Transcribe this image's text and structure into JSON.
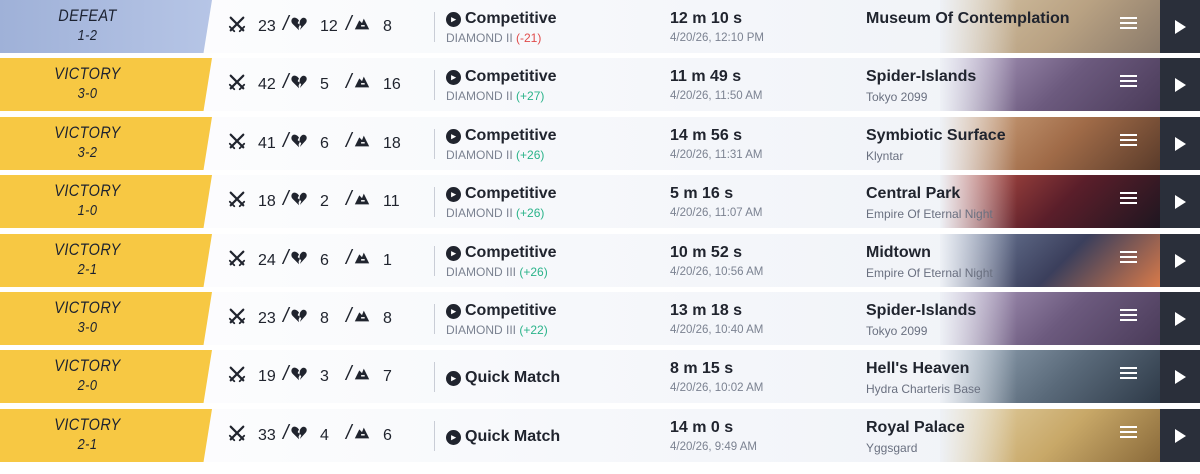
{
  "matches": [
    {
      "result": "DEFEAT",
      "score": "1-2",
      "kills": "23",
      "deaths": "12",
      "assists": "8",
      "mode": "Competitive",
      "rank": "DIAMOND II",
      "rank_change": "(-21)",
      "change_sign": "neg",
      "duration": "12 m 10 s",
      "date": "4/20/26, 12:10 PM",
      "map": "Museum Of Contemplation",
      "region": ""
    },
    {
      "result": "VICTORY",
      "score": "3-0",
      "kills": "42",
      "deaths": "5",
      "assists": "16",
      "mode": "Competitive",
      "rank": "DIAMOND II",
      "rank_change": "(+27)",
      "change_sign": "pos",
      "duration": "11 m 49 s",
      "date": "4/20/26, 11:50 AM",
      "map": "Spider-Islands",
      "region": "Tokyo 2099"
    },
    {
      "result": "VICTORY",
      "score": "3-2",
      "kills": "41",
      "deaths": "6",
      "assists": "18",
      "mode": "Competitive",
      "rank": "DIAMOND II",
      "rank_change": "(+26)",
      "change_sign": "pos",
      "duration": "14 m 56 s",
      "date": "4/20/26, 11:31 AM",
      "map": "Symbiotic Surface",
      "region": "Klyntar"
    },
    {
      "result": "VICTORY",
      "score": "1-0",
      "kills": "18",
      "deaths": "2",
      "assists": "11",
      "mode": "Competitive",
      "rank": "DIAMOND II",
      "rank_change": "(+26)",
      "change_sign": "pos",
      "duration": "5 m 16 s",
      "date": "4/20/26, 11:07 AM",
      "map": "Central Park",
      "region": "Empire Of Eternal Night"
    },
    {
      "result": "VICTORY",
      "score": "2-1",
      "kills": "24",
      "deaths": "6",
      "assists": "1",
      "mode": "Competitive",
      "rank": "DIAMOND III",
      "rank_change": "(+26)",
      "change_sign": "pos",
      "duration": "10 m 52 s",
      "date": "4/20/26, 10:56 AM",
      "map": "Midtown",
      "region": "Empire Of Eternal Night"
    },
    {
      "result": "VICTORY",
      "score": "3-0",
      "kills": "23",
      "deaths": "8",
      "assists": "8",
      "mode": "Competitive",
      "rank": "DIAMOND III",
      "rank_change": "(+22)",
      "change_sign": "pos",
      "duration": "13 m 18 s",
      "date": "4/20/26, 10:40 AM",
      "map": "Spider-Islands",
      "region": "Tokyo 2099"
    },
    {
      "result": "VICTORY",
      "score": "2-0",
      "kills": "19",
      "deaths": "3",
      "assists": "7",
      "mode": "Quick Match",
      "rank": "",
      "rank_change": "",
      "change_sign": "",
      "duration": "8 m 15 s",
      "date": "4/20/26, 10:02 AM",
      "map": "Hell's Heaven",
      "region": "Hydra Charteris Base"
    },
    {
      "result": "VICTORY",
      "score": "2-1",
      "kills": "33",
      "deaths": "4",
      "assists": "6",
      "mode": "Quick Match",
      "rank": "",
      "rank_change": "",
      "change_sign": "",
      "duration": "14 m 0 s",
      "date": "4/20/26, 9:49 AM",
      "map": "Royal Palace",
      "region": "Yggsgard"
    }
  ],
  "icons": {
    "kills": "crossed-swords-icon",
    "deaths": "broken-heart-icon",
    "assists": "helping-hand-icon",
    "platform": "playstation-icon",
    "menu": "menu-icon",
    "replay": "play-icon"
  },
  "colors": {
    "victory": "#f7c843",
    "defeat": "#a9b9de",
    "positive": "#2bb38a",
    "negative": "#e04b4b",
    "play_bg": "#2a2f3a"
  },
  "map_art": [
    [
      "#d9c7a8",
      "#b9a283",
      "#8a7a6a"
    ],
    [
      "#b7a6c8",
      "#6c5a7e",
      "#4a3b59"
    ],
    [
      "#d8b08a",
      "#a06b48",
      "#5a3b2a"
    ],
    [
      "#c85a4a",
      "#5a1e2a",
      "#1e1620"
    ],
    [
      "#7a8aa8",
      "#3b3f5c",
      "#d87a4a"
    ],
    [
      "#b7a6c8",
      "#6c5a7e",
      "#4a3b59"
    ],
    [
      "#9fb0c0",
      "#5a6a7a",
      "#2e3a48"
    ],
    [
      "#e8d8b0",
      "#c8a868",
      "#8a6a3a"
    ]
  ]
}
